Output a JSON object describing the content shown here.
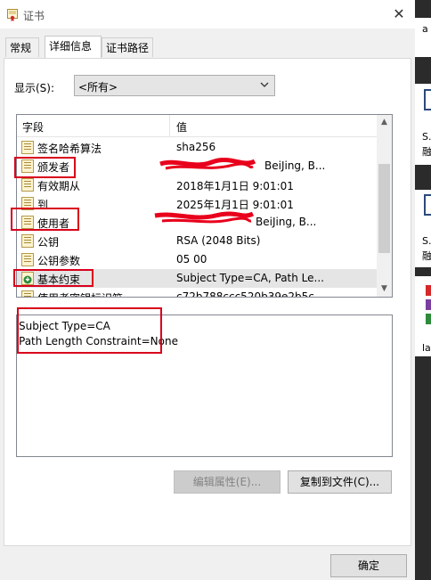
{
  "window": {
    "title": "证书",
    "close_glyph": "✕"
  },
  "tabs": [
    {
      "label": "常规"
    },
    {
      "label": "详细信息"
    },
    {
      "label": "证书路径"
    }
  ],
  "show": {
    "label": "显示(S):",
    "selected": "<所有>"
  },
  "list": {
    "col_field": "字段",
    "col_value": "值",
    "rows": [
      {
        "field": "签名哈希算法",
        "value": "sha256"
      },
      {
        "field": "颁发者",
        "value": "BeiJing, B..."
      },
      {
        "field": "有效期从",
        "value": "2018年1月1日 9:01:01"
      },
      {
        "field": "到",
        "value": "2025年1月1日 9:01:01"
      },
      {
        "field": "使用者",
        "value": "BeiJing, B..."
      },
      {
        "field": "公钥",
        "value": "RSA (2048 Bits)"
      },
      {
        "field": "公钥参数",
        "value": "05 00"
      },
      {
        "field": "基本约束",
        "value": "Subject Type=CA, Path Le..."
      },
      {
        "field": "使用者密钥标识符",
        "value": "c72b788ccc520b39e2b5c..."
      }
    ]
  },
  "detail": {
    "lines": [
      "Subject Type=CA",
      "Path Length Constraint=None"
    ]
  },
  "buttons": {
    "edit": "编辑属性(E)...",
    "copy": "复制到文件(C)...",
    "ok": "确定"
  },
  "background_window": {
    "texts": [
      "a",
      "S.",
      "融",
      "S.",
      "融",
      "la"
    ]
  },
  "colors": {
    "annotation_red": "#d9001b",
    "scribble_red": "#e8001c",
    "selection": "#e5e5e5"
  }
}
